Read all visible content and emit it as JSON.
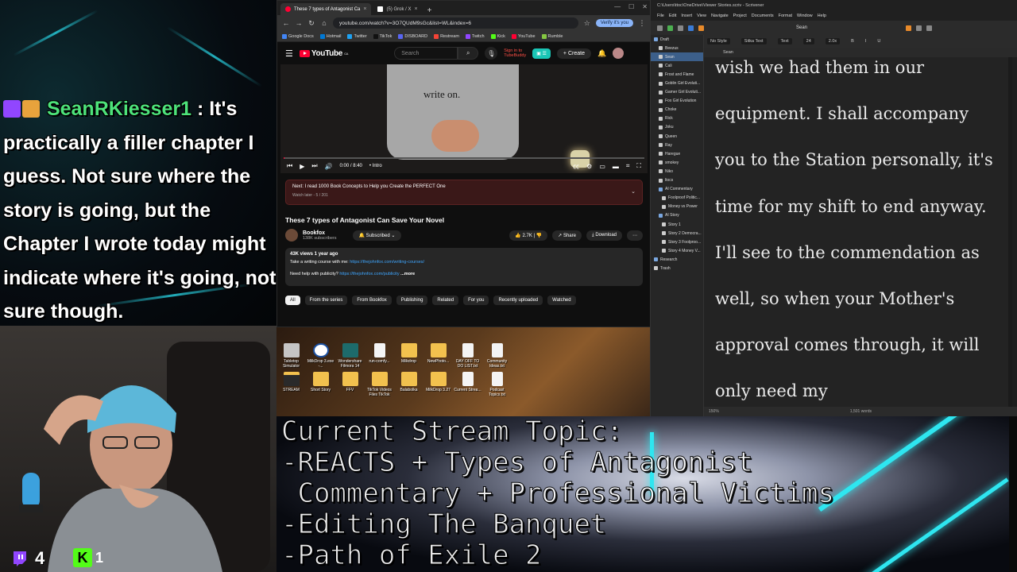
{
  "chat": {
    "username": "SeanRKiesser1",
    "message": ": It's practically a filler chapter I guess. Not sure where the story is going, but the Chapter I wrote today might indicate where it's going, not sure though."
  },
  "viewers": {
    "twitch": "4",
    "kick": "1",
    "kick_logo": "K"
  },
  "browser": {
    "tabs": [
      {
        "title": "These 7 types of Antagonist Ca",
        "active": true
      },
      {
        "title": "(5) Grok / X",
        "active": false
      }
    ],
    "url": "youtube.com/watch?v=3O7QUdM9sGc&list=WL&index=6",
    "verify_label": "Verify it's you",
    "bookmarks": [
      "Google Docs",
      "Hotmail",
      "Twitter",
      "TikTok",
      "DISBOARD",
      "Restream",
      "Twitch",
      "Kick",
      "YouTube",
      "Rumble"
    ],
    "bookmark_colors": [
      "#4285f4",
      "#0078d4",
      "#1da1f2",
      "#111111",
      "#5865f2",
      "#f44336",
      "#9146ff",
      "#53fc18",
      "#ff0033",
      "#85c742"
    ]
  },
  "youtube": {
    "logo": "YouTube",
    "logo_region": "CA",
    "search_placeholder": "Search",
    "signin_line1": "Sign in to",
    "signin_line2": "TubeBuddy",
    "create_label": "Create",
    "shirt_text": "write on.",
    "time": "0:00 / 8:40",
    "chapter": "• Intro",
    "next_title": "Next: I read 1000 Book Concepts to Help you Create the PERFECT One",
    "next_sub": "Watch later - 5 / 201",
    "video_title": "These 7 types of Antagonist Can Save Your Novel",
    "channel_name": "Bookfox",
    "channel_subs": "138K subscribers",
    "subscribed_label": "Subscribed",
    "likes": "2.7K",
    "share_label": "Share",
    "download_label": "Download",
    "desc_meta": "43K views  1 year ago",
    "desc_line1_prefix": "Take a writing course with me: ",
    "desc_line1_link": "https://thejohnfox.com/writing-courses/",
    "desc_line2_prefix": "Need help with publicity? ",
    "desc_line2_link": "https://thejohnfox.com/publicity",
    "desc_more": "...more",
    "chips": [
      "All",
      "From the series",
      "From Bookfox",
      "Publishing",
      "Related",
      "For you",
      "Recently uploaded",
      "Watched"
    ]
  },
  "desktop": {
    "icons": [
      {
        "label": "Tabletop Simulator",
        "kind": "app"
      },
      {
        "label": "MilkDrop 3.exe -...",
        "kind": "milk"
      },
      {
        "label": "Wondershare Filmora 14",
        "kind": "wf"
      },
      {
        "label": "run-comfy...",
        "kind": "file"
      },
      {
        "label": "Milkdrop",
        "kind": "folder"
      },
      {
        "label": "NewPhoto...",
        "kind": "folder"
      },
      {
        "label": "DAY OFF TO DO LIST.txt",
        "kind": "file"
      },
      {
        "label": "Community Ideas.txt",
        "kind": "file"
      },
      {
        "label": "STREAM",
        "kind": "stream"
      },
      {
        "label": "Short Story",
        "kind": "folder"
      },
      {
        "label": "FFV",
        "kind": "folder"
      },
      {
        "label": "TikTok Videos Files TikTok",
        "kind": "folder"
      },
      {
        "label": "Balabolka",
        "kind": "folder"
      },
      {
        "label": "MilkDrop 3.27",
        "kind": "folder"
      },
      {
        "label": "Current Strea...",
        "kind": "file"
      },
      {
        "label": "Podcast Topics.txt",
        "kind": "file"
      }
    ]
  },
  "scrivener": {
    "title": "C:\\Users\\ttoc\\OneDrive\\Viewer Stories.scriv - Scrivener",
    "menu": [
      "File",
      "Edit",
      "Insert",
      "View",
      "Navigate",
      "Project",
      "Documents",
      "Format",
      "Window",
      "Help"
    ],
    "doc_title": "Sean",
    "style": "No Style",
    "font": "Sitka Text",
    "weight": "Text",
    "size": "24",
    "spacing": "2.0x",
    "header_doc": "Sean",
    "binder": [
      {
        "label": "Draft",
        "level": 0,
        "folder": true
      },
      {
        "label": "Beezus",
        "level": 1
      },
      {
        "label": "Sean",
        "level": 1,
        "selected": true
      },
      {
        "label": "Cali",
        "level": 1
      },
      {
        "label": "Frost and Flame",
        "level": 1
      },
      {
        "label": "Goblin Girl Evoluti...",
        "level": 1
      },
      {
        "label": "Gamer Girl Evoluti...",
        "level": 1
      },
      {
        "label": "Fox Girl Evolution",
        "level": 1
      },
      {
        "label": "Choke",
        "level": 1
      },
      {
        "label": "Rick",
        "level": 1
      },
      {
        "label": "Joku",
        "level": 1
      },
      {
        "label": "Queen",
        "level": 1
      },
      {
        "label": "Ray",
        "level": 1
      },
      {
        "label": "Haregue",
        "level": 1
      },
      {
        "label": "smokey",
        "level": 1
      },
      {
        "label": "Niko",
        "level": 1
      },
      {
        "label": "ltocs",
        "level": 1
      },
      {
        "label": "AI Commentary",
        "level": 1,
        "folder": true
      },
      {
        "label": "Foolproof Politic...",
        "level": 2
      },
      {
        "label": "Money vs Power",
        "level": 2
      },
      {
        "label": "AI Story",
        "level": 1,
        "folder": true
      },
      {
        "label": "Story 1",
        "level": 2
      },
      {
        "label": "Story 2 Democra...",
        "level": 2
      },
      {
        "label": "Story 3 Foolproo...",
        "level": 2
      },
      {
        "label": "Story 4 Money V...",
        "level": 2
      },
      {
        "label": "Research",
        "level": 0,
        "folder": true
      },
      {
        "label": "Trash",
        "level": 0
      }
    ],
    "editor_text": "wish we had them in our equipment. I shall accompany you to the Station personally, it's time for my shift to end anyway. I'll see to the commendation as well, so when your Mother's approval comes through, it will only need my",
    "zoom": "150%",
    "word_count": "1,501 words"
  },
  "topic": {
    "text": "Current Stream Topic:\n-REACTS + Types of Antagonist\n Commentary + Professional Victims\n-Editing The Banquet\n-Path of Exile 2"
  }
}
